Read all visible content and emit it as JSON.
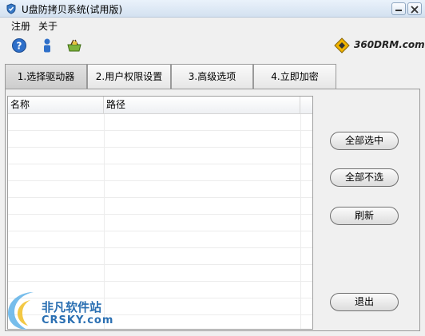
{
  "window": {
    "title": "U盘防拷贝系统(试用版)"
  },
  "menu": {
    "items": [
      "注册",
      "关于"
    ]
  },
  "toolbar": {
    "icons": [
      "help-icon",
      "user-info-icon",
      "basket-icon"
    ]
  },
  "brand": {
    "text": "360DRM.com"
  },
  "tabs": [
    {
      "label": "1.选择驱动器",
      "active": true
    },
    {
      "label": "2.用户权限设置",
      "active": false
    },
    {
      "label": "3.高级选项",
      "active": false
    },
    {
      "label": "4.立即加密",
      "active": false
    }
  ],
  "table": {
    "columns": [
      "名称",
      "路径"
    ],
    "rows": []
  },
  "buttons": {
    "select_all": "全部选中",
    "select_none": "全部不选",
    "refresh": "刷新",
    "exit": "退出"
  },
  "watermark": {
    "line1": "非凡软件站",
    "line2": "CRSKY.com"
  },
  "colors": {
    "accent": "#2a6fb2",
    "titlebar": "#d3e1f0"
  }
}
